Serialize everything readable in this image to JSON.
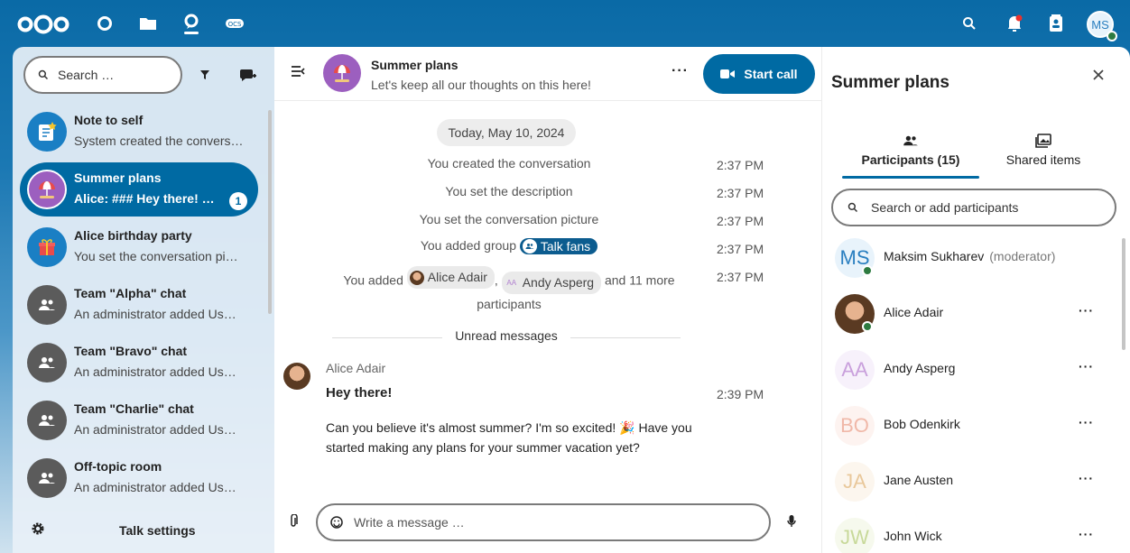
{
  "topbar": {
    "apps": [
      "dashboard-icon",
      "files-icon",
      "talk-icon",
      "office-icon"
    ],
    "right_icons": [
      "search-icon",
      "notifications-icon",
      "contacts-icon"
    ],
    "avatar_initials": "MS"
  },
  "left": {
    "search_placeholder": "Search …",
    "conversations": [
      {
        "name": "Note to self",
        "preview": "System created the convers…"
      },
      {
        "name": "Summer plans",
        "preview": "Alice: ### Hey there! …",
        "unread": "1",
        "active": true
      },
      {
        "name": "Alice birthday party",
        "preview": "You set the conversation pi…"
      },
      {
        "name": "Team \"Alpha\" chat",
        "preview": "An administrator added Us…"
      },
      {
        "name": "Team \"Bravo\" chat",
        "preview": "An administrator added Us…"
      },
      {
        "name": "Team \"Charlie\" chat",
        "preview": "An administrator added Us…"
      },
      {
        "name": "Off-topic room",
        "preview": "An administrator added Us…"
      }
    ],
    "settings_label": "Talk settings"
  },
  "chat": {
    "title": "Summer plans",
    "description": "Let's keep all our thoughts on this here!",
    "more": "···",
    "call_label": "Start call",
    "date": "Today, May 10, 2024",
    "system": [
      {
        "text": "You created the conversation",
        "time": "2:37 PM"
      },
      {
        "text": "You set the description",
        "time": "2:37 PM"
      },
      {
        "text": "You set the conversation picture",
        "time": "2:37 PM"
      },
      {
        "prefix": "You added group",
        "chip": "Talk fans",
        "time": "2:37 PM"
      },
      {
        "prefix": "You added",
        "chip1": "Alice Adair",
        "sep": ",",
        "chip2": "Andy Asperg",
        "chip2_initials": "AA",
        "suffix": "and 11 more",
        "line2": "participants",
        "time": "2:37 PM"
      }
    ],
    "unread_label": "Unread messages",
    "message": {
      "author": "Alice Adair",
      "heading": "Hey there!",
      "time": "2:39 PM",
      "body": "Can you believe it's almost summer? I'm so excited! 🎉 Have you started making any plans for your summer vacation yet?"
    },
    "composer_placeholder": "Write a message …"
  },
  "sidebar": {
    "title": "Summer plans",
    "tabs": [
      {
        "label": "Participants (15)",
        "icon": "participants-icon",
        "active": true
      },
      {
        "label": "Shared items",
        "icon": "shared-items-icon"
      }
    ],
    "search_placeholder": "Search or add participants",
    "participants": [
      {
        "name": "Maksim Sukharev",
        "role": "(moderator)",
        "initials": "MS",
        "color": "#2a7fc0",
        "bg": "#e8f3fb",
        "online": true
      },
      {
        "name": "Alice Adair",
        "photo": true,
        "online": true
      },
      {
        "name": "Andy Asperg",
        "initials": "AA",
        "color": "#c9a0dc",
        "bg": "#f7f1fb"
      },
      {
        "name": "Bob Odenkirk",
        "initials": "BO",
        "color": "#f0b8a8",
        "bg": "#fdf3f0"
      },
      {
        "name": "Jane Austen",
        "initials": "JA",
        "color": "#e9c89b",
        "bg": "#fcf6ee"
      },
      {
        "name": "John Wick",
        "initials": "JW",
        "color": "#c8d99a",
        "bg": "#f6f9ed"
      }
    ],
    "menu_glyph": "···"
  }
}
